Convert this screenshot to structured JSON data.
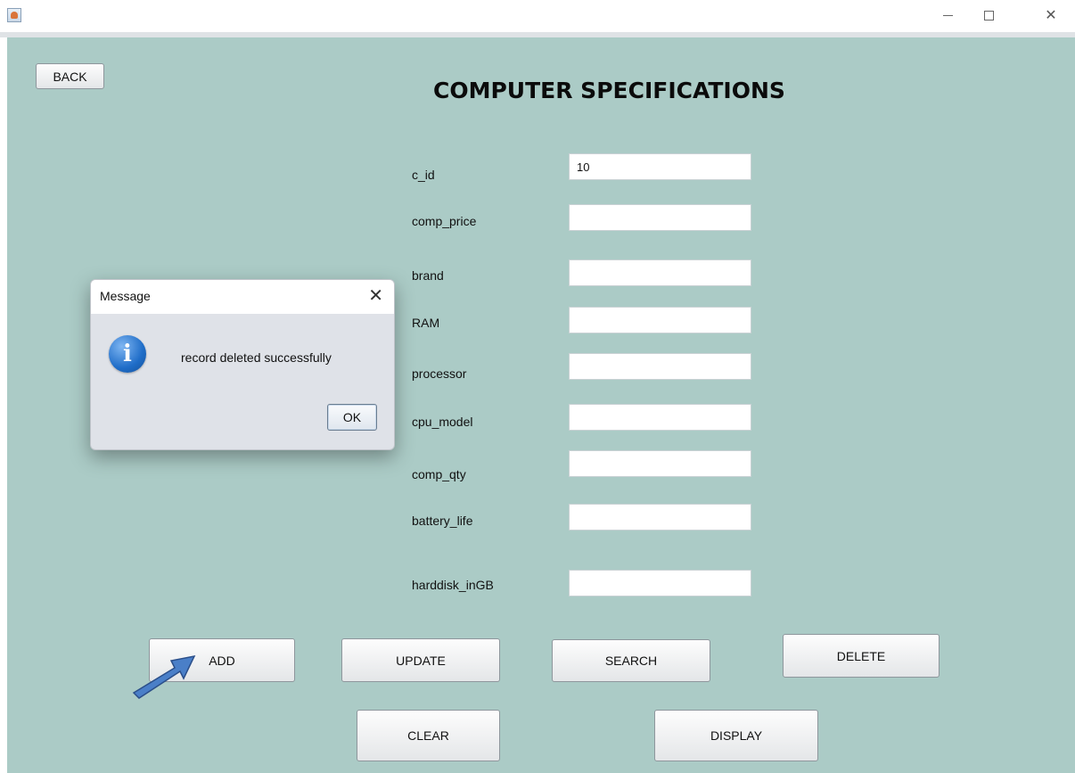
{
  "window": {
    "minimize_glyph": "—",
    "close_glyph": "✕"
  },
  "back_label": "BACK",
  "title": "COMPUTER SPECIFICATIONS",
  "fields": [
    {
      "label": "c_id",
      "value": "10"
    },
    {
      "label": "comp_price",
      "value": ""
    },
    {
      "label": "brand",
      "value": ""
    },
    {
      "label": "RAM",
      "value": ""
    },
    {
      "label": "processor",
      "value": ""
    },
    {
      "label": "cpu_model",
      "value": ""
    },
    {
      "label": "comp_qty",
      "value": ""
    },
    {
      "label": "battery_life",
      "value": ""
    },
    {
      "label": "harddisk_inGB",
      "value": ""
    }
  ],
  "buttons": {
    "add": "ADD",
    "update": "UPDATE",
    "search": "SEARCH",
    "delete": "DELETE",
    "clear": "CLEAR",
    "display": "DISPLAY"
  },
  "dialog": {
    "title": "Message",
    "close_glyph": "✕",
    "icon_glyph": "i",
    "message": "record deleted successfully",
    "ok_label": "OK"
  },
  "colors": {
    "background": "#abcbc6",
    "arrow": "#4a7fc8"
  }
}
